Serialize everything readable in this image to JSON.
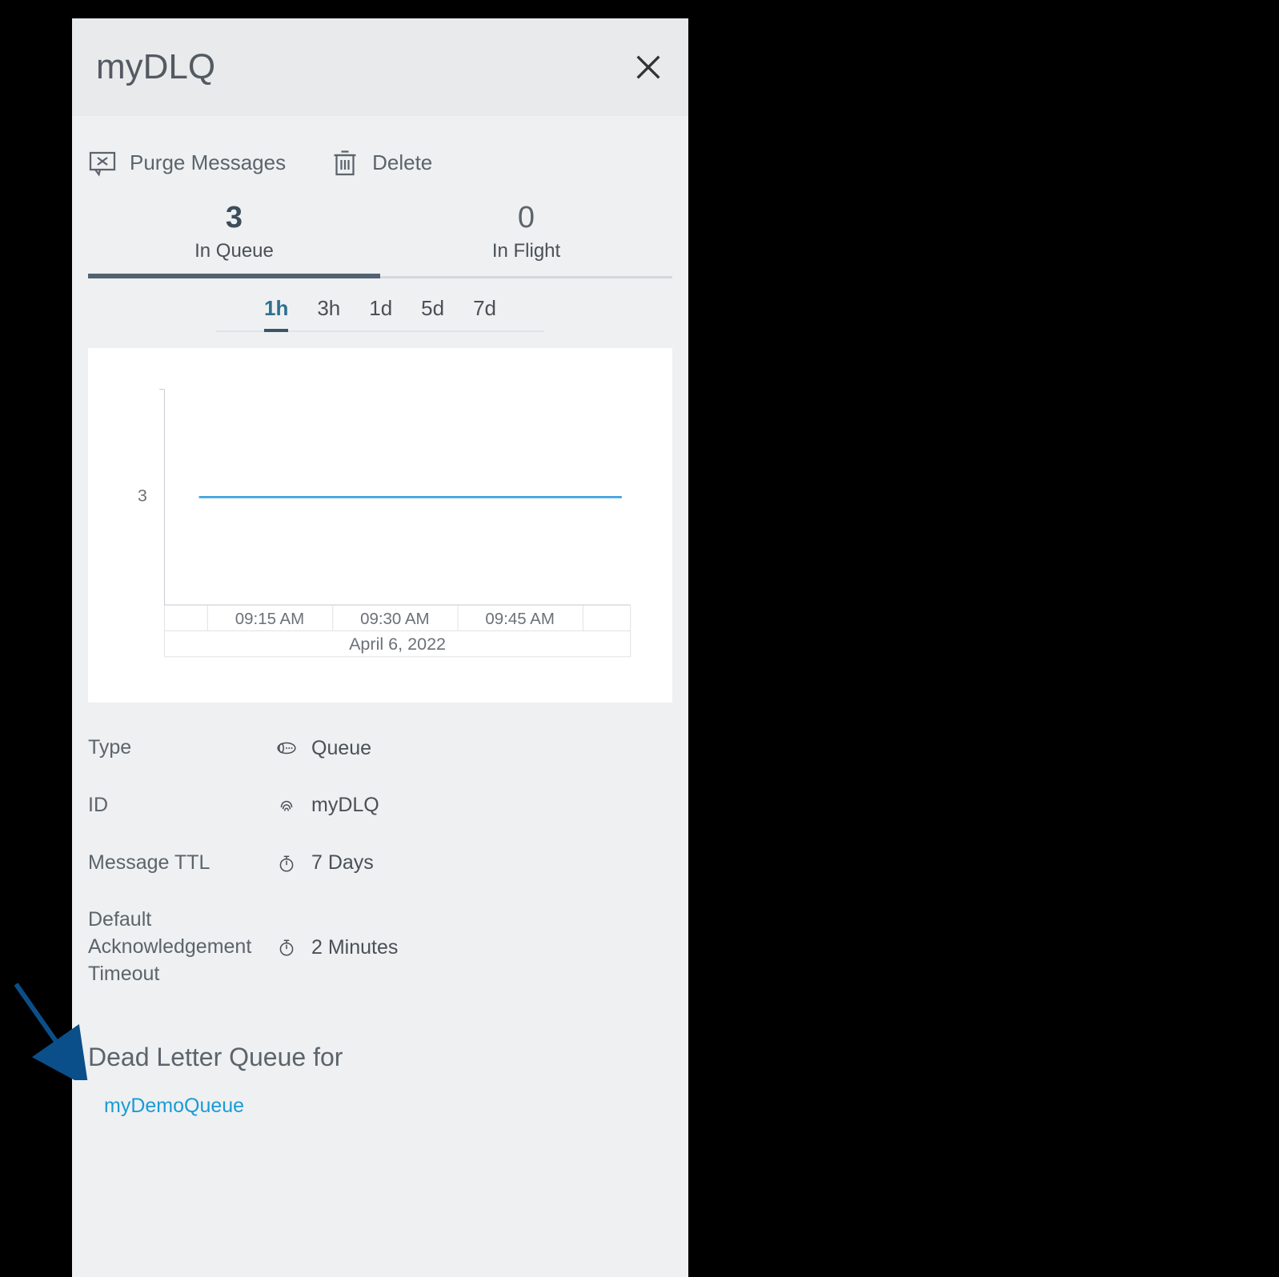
{
  "header": {
    "title": "myDLQ"
  },
  "actions": {
    "purge_label": "Purge Messages",
    "delete_label": "Delete"
  },
  "count_tabs": {
    "in_queue": {
      "value": "3",
      "label": "In Queue",
      "active": true
    },
    "in_flight": {
      "value": "0",
      "label": "In Flight",
      "active": false
    }
  },
  "range_tabs": [
    "1h",
    "3h",
    "1d",
    "5d",
    "7d"
  ],
  "range_active": "1h",
  "chart_data": {
    "type": "line",
    "title": "",
    "xlabel": "April 6, 2022",
    "ylabel": "",
    "y_ticks": [
      3
    ],
    "x_ticks": [
      "09:15 AM",
      "09:30 AM",
      "09:45 AM"
    ],
    "series": [
      {
        "name": "In Queue",
        "values": [
          3,
          3,
          3,
          3,
          3
        ],
        "color": "#3aa0e0"
      }
    ],
    "ylim": [
      0,
      6
    ]
  },
  "details": {
    "type": {
      "label": "Type",
      "value": "Queue"
    },
    "id": {
      "label": "ID",
      "value": "myDLQ"
    },
    "ttl": {
      "label": "Message TTL",
      "value": "7 Days"
    },
    "ack": {
      "label": "Default Acknowledgement Timeout",
      "value": "2 Minutes"
    }
  },
  "dlq_section": {
    "heading": "Dead Letter Queue for",
    "linked_queue": "myDemoQueue"
  }
}
